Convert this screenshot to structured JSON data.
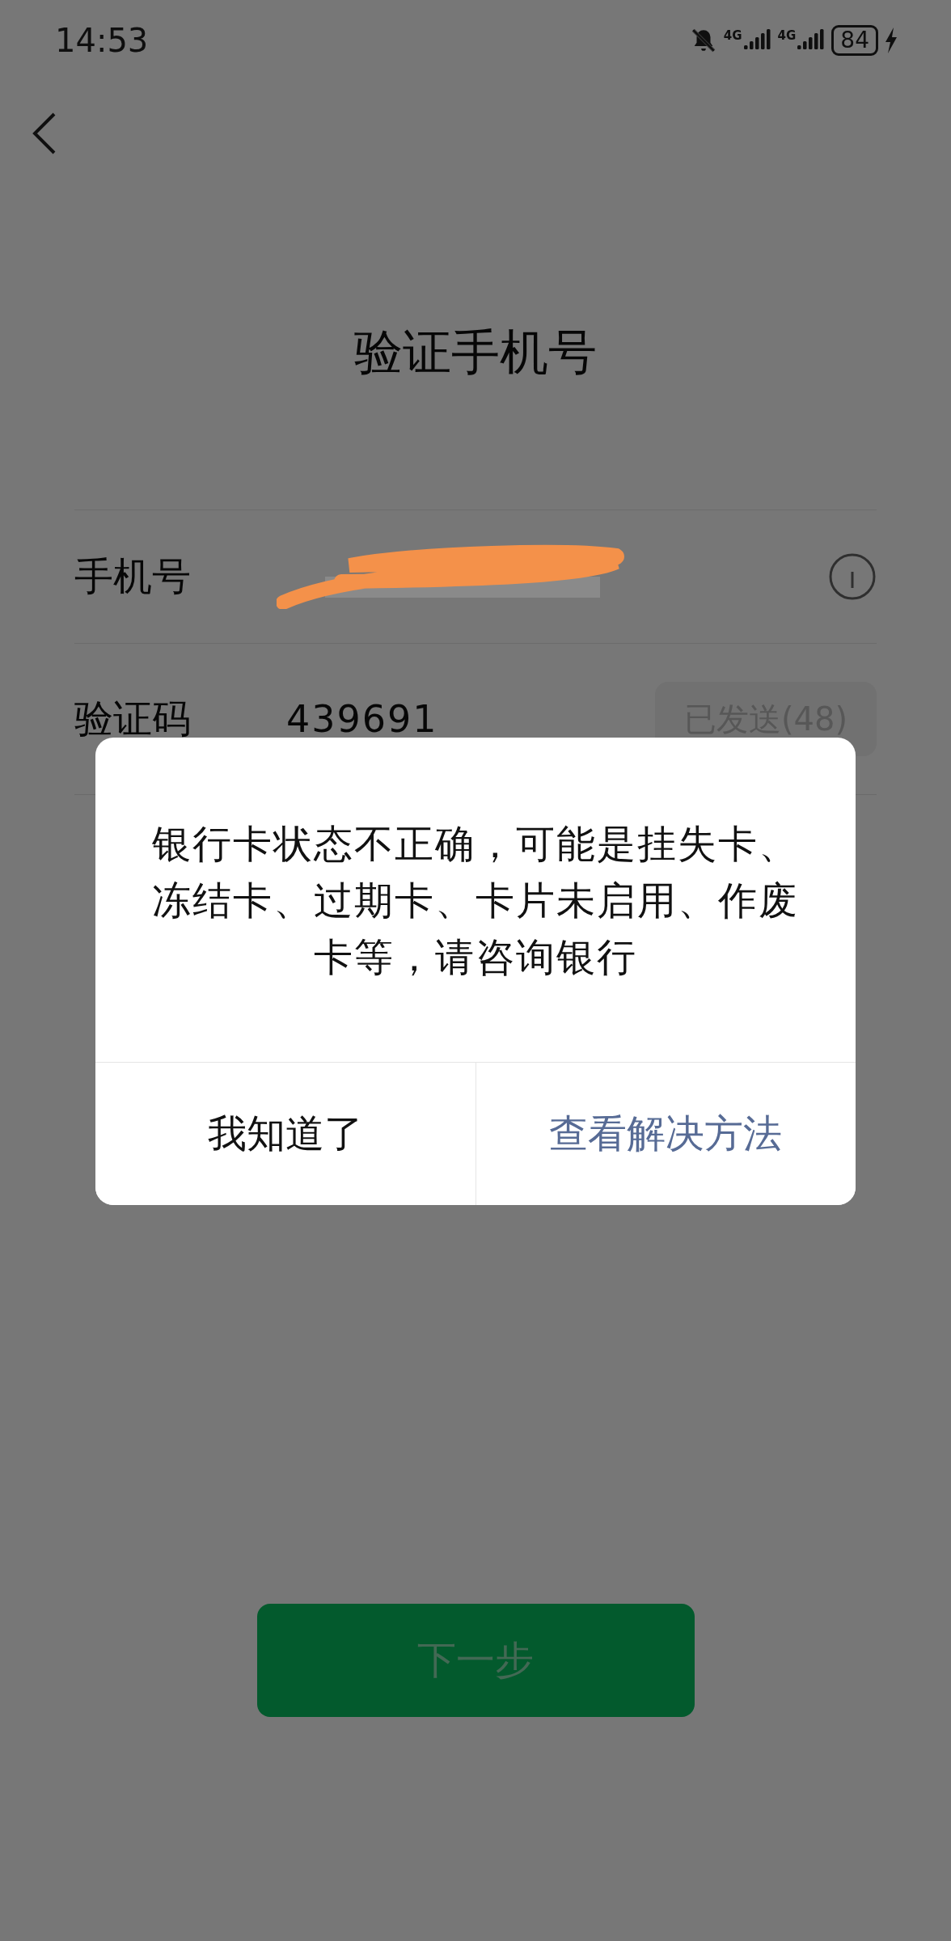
{
  "status_bar": {
    "time": "14:53",
    "signals": [
      {
        "network": "4G"
      },
      {
        "network": "4G"
      }
    ],
    "battery": "84",
    "charging": true
  },
  "title": "验证手机号",
  "phone_row": {
    "label": "手机号"
  },
  "code_row": {
    "label": "验证码",
    "value": "439691",
    "resend_button": {
      "label": "已发送(48)",
      "disabled": true
    }
  },
  "dialog": {
    "message": "银行卡状态不正确，可能是挂失卡、冻结卡、过期卡、卡片未启用、作废卡等，请咨询银行",
    "buttons": [
      {
        "label": "我知道了",
        "kind": "plain"
      },
      {
        "label": "查看解决方法",
        "kind": "primary"
      }
    ]
  },
  "next_button": {
    "label": "下一步",
    "disabled": true
  }
}
